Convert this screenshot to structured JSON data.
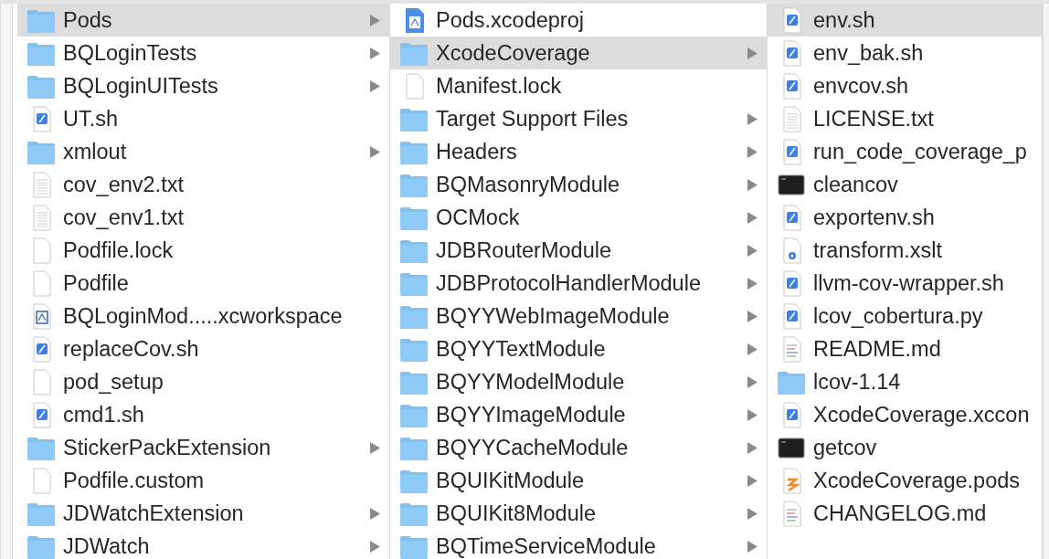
{
  "columns": [
    {
      "items": [
        {
          "name": "Pods",
          "kind": "folder",
          "selected": true,
          "disclosure": true
        },
        {
          "name": "BQLoginTests",
          "kind": "folder",
          "selected": false,
          "disclosure": true
        },
        {
          "name": "BQLoginUITests",
          "kind": "folder",
          "selected": false,
          "disclosure": true
        },
        {
          "name": "UT.sh",
          "kind": "script",
          "selected": false,
          "disclosure": false
        },
        {
          "name": "xmlout",
          "kind": "folder",
          "selected": false,
          "disclosure": true
        },
        {
          "name": "cov_env2.txt",
          "kind": "text",
          "selected": false,
          "disclosure": false
        },
        {
          "name": "cov_env1.txt",
          "kind": "text",
          "selected": false,
          "disclosure": false
        },
        {
          "name": "Podfile.lock",
          "kind": "blank",
          "selected": false,
          "disclosure": false
        },
        {
          "name": "Podfile",
          "kind": "blank",
          "selected": false,
          "disclosure": false
        },
        {
          "name": "BQLoginMod.....xcworkspace",
          "kind": "workspace",
          "selected": false,
          "disclosure": false
        },
        {
          "name": "replaceCov.sh",
          "kind": "script",
          "selected": false,
          "disclosure": false
        },
        {
          "name": "pod_setup",
          "kind": "blank",
          "selected": false,
          "disclosure": false
        },
        {
          "name": "cmd1.sh",
          "kind": "script",
          "selected": false,
          "disclosure": false
        },
        {
          "name": "StickerPackExtension",
          "kind": "folder",
          "selected": false,
          "disclosure": true
        },
        {
          "name": "Podfile.custom",
          "kind": "blank",
          "selected": false,
          "disclosure": false
        },
        {
          "name": "JDWatchExtension",
          "kind": "folder",
          "selected": false,
          "disclosure": true
        },
        {
          "name": "JDWatch",
          "kind": "folder",
          "selected": false,
          "disclosure": true
        }
      ]
    },
    {
      "items": [
        {
          "name": "Pods.xcodeproj",
          "kind": "project",
          "selected": false,
          "disclosure": false
        },
        {
          "name": "XcodeCoverage",
          "kind": "folder",
          "selected": true,
          "disclosure": true
        },
        {
          "name": "Manifest.lock",
          "kind": "blank",
          "selected": false,
          "disclosure": false
        },
        {
          "name": "Target Support Files",
          "kind": "folder",
          "selected": false,
          "disclosure": true
        },
        {
          "name": "Headers",
          "kind": "folder",
          "selected": false,
          "disclosure": true
        },
        {
          "name": "BQMasonryModule",
          "kind": "folder",
          "selected": false,
          "disclosure": true
        },
        {
          "name": "OCMock",
          "kind": "folder",
          "selected": false,
          "disclosure": true
        },
        {
          "name": "JDBRouterModule",
          "kind": "folder",
          "selected": false,
          "disclosure": true
        },
        {
          "name": "JDBProtocolHandlerModule",
          "kind": "folder",
          "selected": false,
          "disclosure": true
        },
        {
          "name": "BQYYWebImageModule",
          "kind": "folder",
          "selected": false,
          "disclosure": true
        },
        {
          "name": "BQYYTextModule",
          "kind": "folder",
          "selected": false,
          "disclosure": true
        },
        {
          "name": "BQYYModelModule",
          "kind": "folder",
          "selected": false,
          "disclosure": true
        },
        {
          "name": "BQYYImageModule",
          "kind": "folder",
          "selected": false,
          "disclosure": true
        },
        {
          "name": "BQYYCacheModule",
          "kind": "folder",
          "selected": false,
          "disclosure": true
        },
        {
          "name": "BQUIKitModule",
          "kind": "folder",
          "selected": false,
          "disclosure": true
        },
        {
          "name": "BQUIKit8Module",
          "kind": "folder",
          "selected": false,
          "disclosure": true
        },
        {
          "name": "BQTimeServiceModule",
          "kind": "folder",
          "selected": false,
          "disclosure": true
        }
      ]
    },
    {
      "items": [
        {
          "name": "env.sh",
          "kind": "script",
          "selected": true,
          "disclosure": false
        },
        {
          "name": "env_bak.sh",
          "kind": "script",
          "selected": false,
          "disclosure": false
        },
        {
          "name": "envcov.sh",
          "kind": "script",
          "selected": false,
          "disclosure": false
        },
        {
          "name": "LICENSE.txt",
          "kind": "text",
          "selected": false,
          "disclosure": false
        },
        {
          "name": "run_code_coverage_p",
          "kind": "script",
          "selected": false,
          "disclosure": false
        },
        {
          "name": "cleancov",
          "kind": "terminal",
          "selected": false,
          "disclosure": false
        },
        {
          "name": "exportenv.sh",
          "kind": "script",
          "selected": false,
          "disclosure": false
        },
        {
          "name": "transform.xslt",
          "kind": "xslt",
          "selected": false,
          "disclosure": false
        },
        {
          "name": "llvm-cov-wrapper.sh",
          "kind": "script",
          "selected": false,
          "disclosure": false
        },
        {
          "name": "lcov_cobertura.py",
          "kind": "script",
          "selected": false,
          "disclosure": false
        },
        {
          "name": "README.md",
          "kind": "markdown",
          "selected": false,
          "disclosure": false
        },
        {
          "name": "lcov-1.14",
          "kind": "folder",
          "selected": false,
          "disclosure": false
        },
        {
          "name": "XcodeCoverage.xccon",
          "kind": "script",
          "selected": false,
          "disclosure": false
        },
        {
          "name": "getcov",
          "kind": "terminal",
          "selected": false,
          "disclosure": false
        },
        {
          "name": "XcodeCoverage.pods",
          "kind": "swift",
          "selected": false,
          "disclosure": false
        },
        {
          "name": "CHANGELOG.md",
          "kind": "markdown",
          "selected": false,
          "disclosure": false
        }
      ]
    }
  ]
}
